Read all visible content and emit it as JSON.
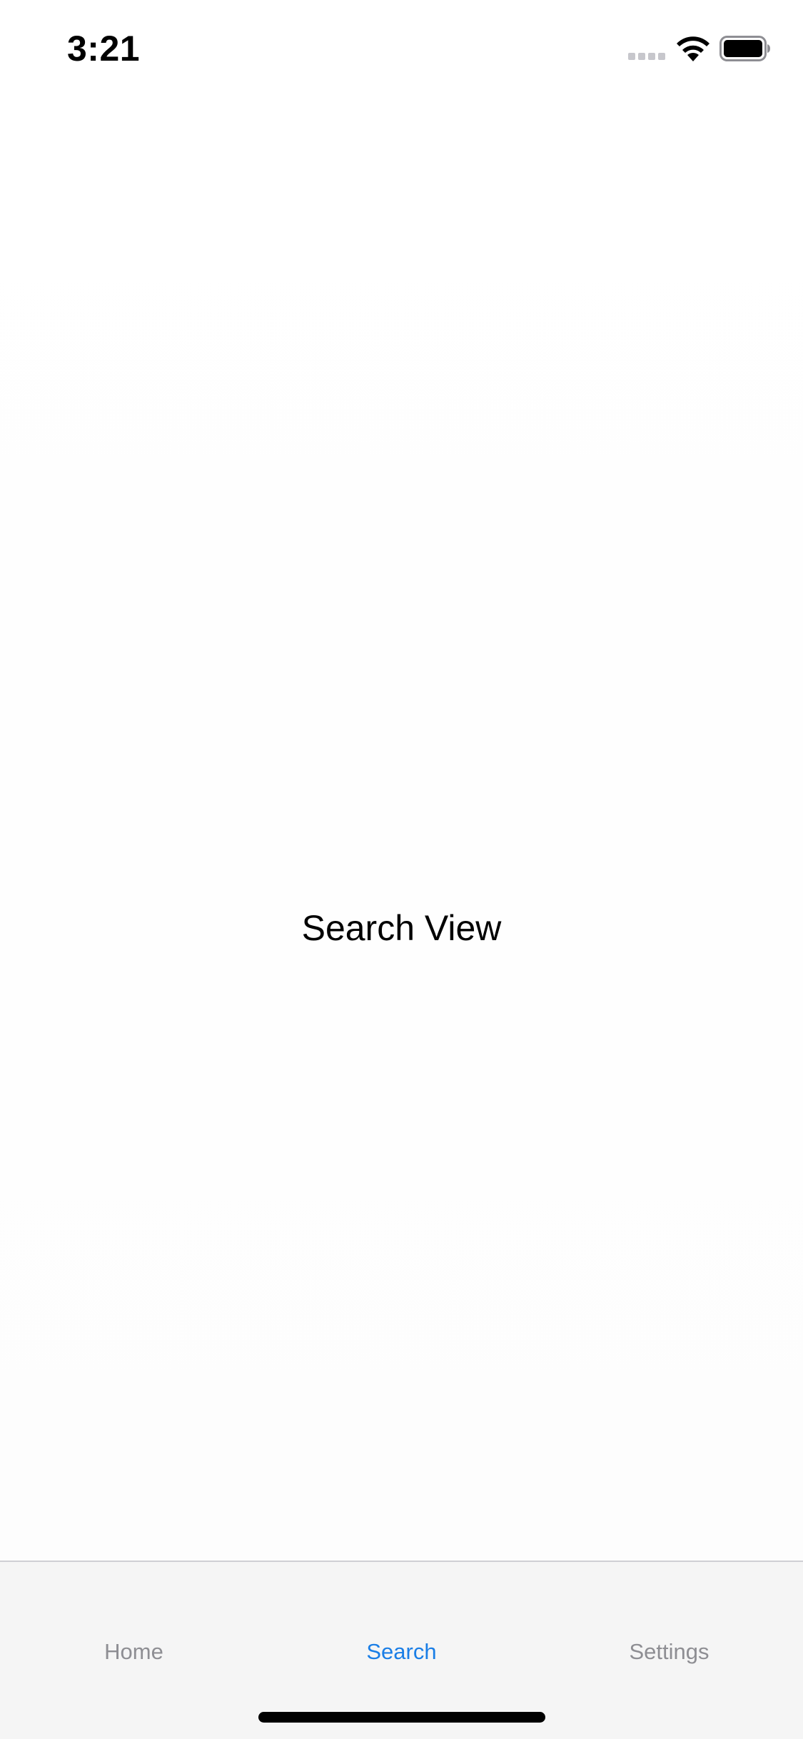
{
  "status_bar": {
    "time": "3:21",
    "signal_icon": "cellular-signal-icon",
    "wifi_icon": "wifi-icon",
    "battery_icon": "battery-icon"
  },
  "main": {
    "title": "Search View"
  },
  "tab_bar": {
    "active_index": 1,
    "active_color": "#1a7ee6",
    "inactive_color": "#8e8e93",
    "tabs": [
      {
        "label": "Home"
      },
      {
        "label": "Search"
      },
      {
        "label": "Settings"
      }
    ]
  }
}
